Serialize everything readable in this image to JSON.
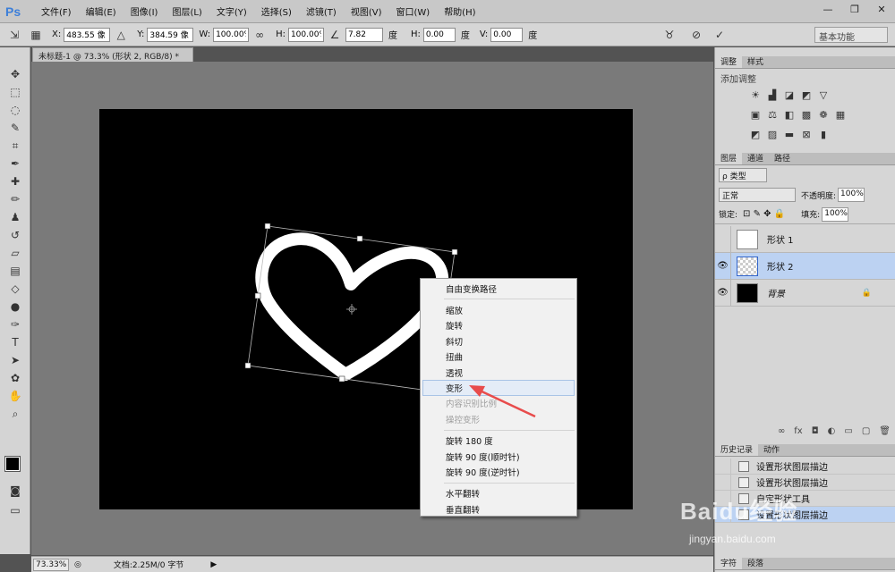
{
  "app": {
    "logo": "Ps"
  },
  "menu": [
    "文件(F)",
    "编辑(E)",
    "图像(I)",
    "图层(L)",
    "文字(Y)",
    "选择(S)",
    "滤镜(T)",
    "视图(V)",
    "窗口(W)",
    "帮助(H)"
  ],
  "window_controls": {
    "minimize": "—",
    "maximize": "❐",
    "close": "✕"
  },
  "options": {
    "x_label": "X:",
    "x_value": "483.55 像",
    "y_label": "Y:",
    "y_value": "384.59 像",
    "w_label": "W:",
    "w_value": "100.00%",
    "h_label": "H:",
    "h_value": "100.00%",
    "angle_value": "7.82",
    "angle_unit": "度",
    "hskew_label": "H:",
    "hskew_value": "0.00",
    "hskew_unit": "度",
    "vskew_label": "V:",
    "vskew_value": "0.00",
    "vskew_unit": "度",
    "workspace": "基本功能"
  },
  "doc_tab": {
    "title": "未标题-1 @ 73.3% (形状 2, RGB/8) *",
    "close": "×"
  },
  "panels": {
    "adjust_tabs": [
      "调整",
      "样式"
    ],
    "adjust_title": "添加调整",
    "layers_tabs": [
      "图层",
      "通道",
      "路径"
    ],
    "layers_filter": "ρ 类型",
    "blend_mode": "正常",
    "opacity_label": "不透明度:",
    "opacity_value": "100%",
    "lock_label": "锁定:",
    "fill_label": "填充:",
    "fill_value": "100%",
    "layers": [
      {
        "name": "形状 1",
        "visible": false,
        "selected": false
      },
      {
        "name": "形状 2",
        "visible": true,
        "selected": true
      },
      {
        "name": "背景",
        "visible": true,
        "selected": false
      }
    ],
    "history_tabs": [
      "历史记录",
      "动作"
    ],
    "history": [
      "设置形状图层描边",
      "设置形状图层描边",
      "自定形状工具",
      "设置形状图层描边"
    ],
    "bottom_tabs": [
      "字符",
      "段落"
    ]
  },
  "status": {
    "zoom": "73.33%",
    "doc_info": "文档:2.25M/0 字节"
  },
  "context_menu": {
    "group1": [
      "自由变换路径"
    ],
    "group2": [
      "缩放",
      "旋转",
      "斜切",
      "扭曲",
      "透视",
      "变形",
      "内容识别比例",
      "操控变形"
    ],
    "group3": [
      "旋转 180 度",
      "旋转 90 度(顺时针)",
      "旋转 90 度(逆时针)"
    ],
    "group4": [
      "水平翻转",
      "垂直翻转"
    ]
  },
  "watermark": {
    "brand": "Baidu经验",
    "url": "jingyan.baidu.com"
  },
  "colors": {
    "accent_arrow": "#e84c4c",
    "selection": "#bcd2f2",
    "canvas": "#000000"
  }
}
